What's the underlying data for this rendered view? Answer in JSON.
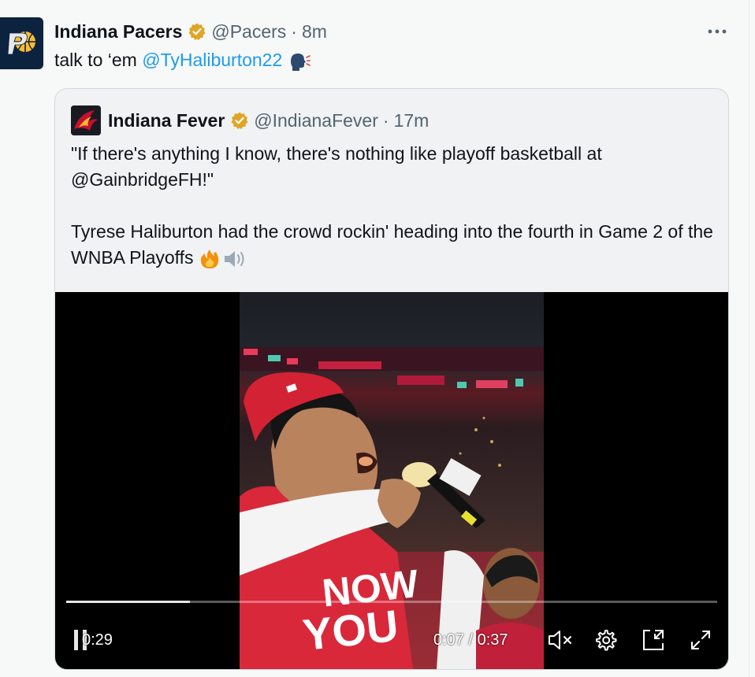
{
  "post": {
    "author_name": "Indiana Pacers",
    "handle": "@Pacers",
    "separator": "·",
    "time": "8m",
    "text_prefix": "talk to ‘em ",
    "mention": "@TyHaliburton22",
    "emoji_icon": "speaking-head-icon",
    "more_label": "•••"
  },
  "quote": {
    "author_name": "Indiana Fever",
    "handle": "@IndianaFever",
    "separator": "·",
    "time": "17m",
    "paragraph1": "\"If there's anything I know, there's nothing like playoff basketball at @GainbridgeFH!\"",
    "paragraph2": "Tyrese Haliburton had the crowd rockin' heading into the fourth in Game 2 of the WNBA Playoffs",
    "emoji_icons": [
      "fire-icon",
      "speaker-icon"
    ]
  },
  "video": {
    "shirt_text_line1": "NOW",
    "shirt_text_line2": "YOU",
    "progress": 0.19,
    "remaining_time": "0:29",
    "current_time": "0:07 / 0:37",
    "muted": true
  },
  "colors": {
    "link": "#1d9bf0",
    "verified": "#e0a526",
    "secondary_text": "#536471"
  }
}
